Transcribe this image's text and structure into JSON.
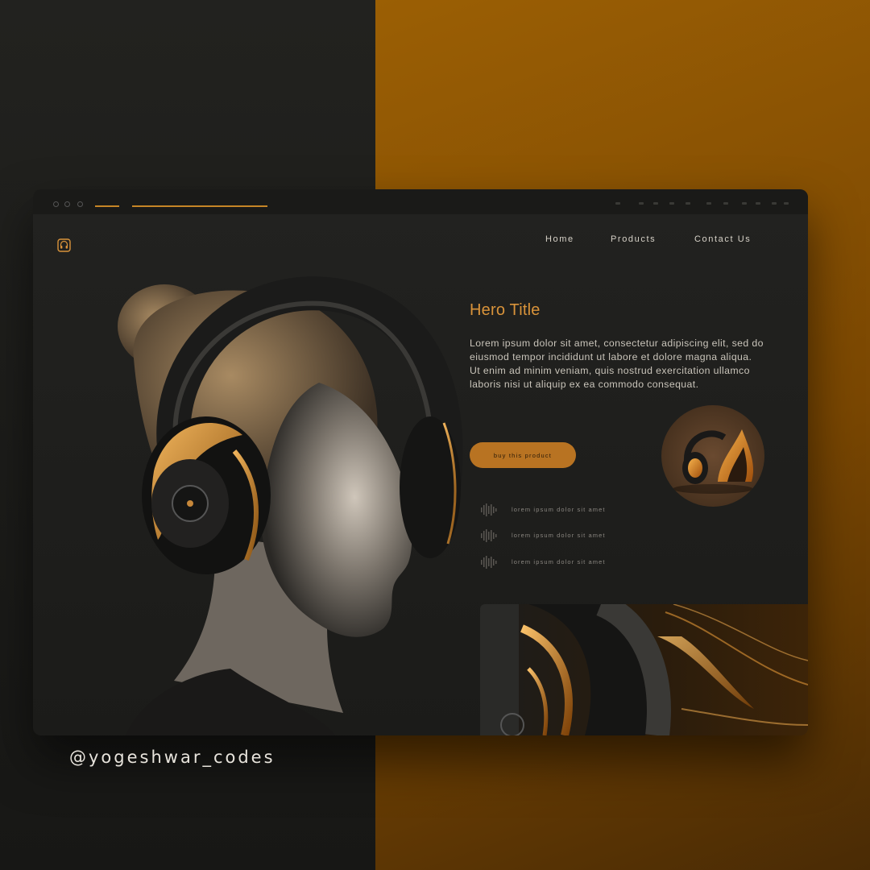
{
  "nav": {
    "home": "Home",
    "products": "Products",
    "contact": "Contact Us"
  },
  "hero": {
    "title": "Hero Title",
    "description": "Lorem ipsum dolor sit amet, consectetur adipiscing elit, sed do eiusmod tempor incididunt ut labore et dolore magna aliqua. Ut enim ad minim veniam, quis nostrud exercitation ullamco laboris nisi ut aliquip ex ea commodo consequat.",
    "cta_label": "buy this product"
  },
  "features": [
    {
      "icon": "sound-wave-icon",
      "text": "lorem ipsum dolor sit amet"
    },
    {
      "icon": "sound-wave-icon",
      "text": "lorem ipsum dolor sit amet"
    },
    {
      "icon": "sound-wave-icon",
      "text": "lorem ipsum dolor sit amet"
    }
  ],
  "credit": "@yogeshwar_codes",
  "colors": {
    "accent": "#d9933a",
    "button": "#b87322",
    "background_dark": "#1c1c1a",
    "background_gold": "#8a5203"
  }
}
